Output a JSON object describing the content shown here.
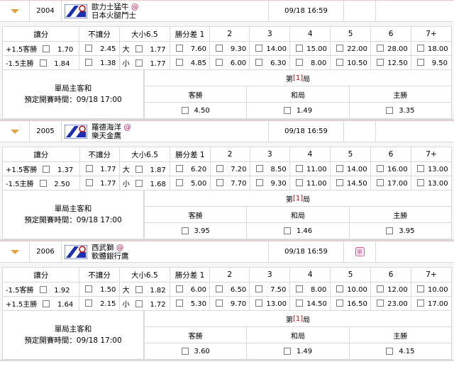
{
  "games": [
    {
      "no": "2004",
      "away": "歐力士猛牛",
      "home": "日本火腿鬥士",
      "at": "@",
      "time": "09/18 16:59",
      "badge": "",
      "headers": [
        "讓分",
        "不讓分",
        "大小6.5",
        "勝分差 1",
        "2",
        "3",
        "4",
        "5",
        "6",
        "7+"
      ],
      "rows": [
        {
          "hcap": "+1.5客勝",
          "hodd": "1.70",
          "nodd": "2.45",
          "ou": "大",
          "ouodd": "1.77",
          "m": [
            "7.60",
            "9.30",
            "14.00",
            "15.00",
            "22.00",
            "28.00",
            "18.00"
          ]
        },
        {
          "hcap": "-1.5主勝",
          "hodd": "1.84",
          "nodd": "1.38",
          "ou": "小",
          "ouodd": "1.77",
          "m": [
            "4.85",
            "6.00",
            "6.30",
            "8.00",
            "10.50",
            "12.50",
            "9.50"
          ]
        }
      ],
      "inning_title": "單局主客和",
      "start": "預定開賽時間：09/18 17:00",
      "inning": [
        "第",
        "1",
        "局"
      ],
      "cols": [
        "客勝",
        "和局",
        "主勝"
      ],
      "codds": [
        "4.50",
        "1.49",
        "3.35"
      ]
    },
    {
      "no": "2005",
      "away": "羅德海洋",
      "home": "樂天金鷹",
      "at": "@",
      "time": "09/18 16:59",
      "badge": "",
      "headers": [
        "讓分",
        "不讓分",
        "大小6.5",
        "勝分差 1",
        "2",
        "3",
        "4",
        "5",
        "6",
        "7+"
      ],
      "rows": [
        {
          "hcap": "+1.5客勝",
          "hodd": "1.37",
          "nodd": "1.77",
          "ou": "大",
          "ouodd": "1.87",
          "m": [
            "6.20",
            "7.20",
            "8.50",
            "11.00",
            "14.00",
            "16.00",
            "13.00"
          ]
        },
        {
          "hcap": "-1.5主勝",
          "hodd": "2.50",
          "nodd": "1.77",
          "ou": "小",
          "ouodd": "1.68",
          "m": [
            "5.00",
            "7.70",
            "9.30",
            "11.00",
            "14.50",
            "17.00",
            "13.00"
          ]
        }
      ],
      "inning_title": "單局主客和",
      "start": "預定開賽時間：09/18 17:00",
      "inning": [
        "第",
        "1",
        "局"
      ],
      "cols": [
        "客勝",
        "和局",
        "主勝"
      ],
      "codds": [
        "3.95",
        "1.46",
        "3.95"
      ]
    },
    {
      "no": "2006",
      "away": "西武獅",
      "home": "軟體銀行鷹",
      "at": "@",
      "time": "09/18 16:59",
      "badge": "單",
      "headers": [
        "讓分",
        "不讓分",
        "大小6.5",
        "勝分差 1",
        "2",
        "3",
        "4",
        "5",
        "6",
        "7+"
      ],
      "rows": [
        {
          "hcap": "-1.5客勝",
          "hodd": "1.92",
          "nodd": "1.50",
          "ou": "大",
          "ouodd": "1.82",
          "m": [
            "6.00",
            "6.50",
            "7.50",
            "8.00",
            "10.00",
            "12.00",
            "10.00"
          ]
        },
        {
          "hcap": "+1.5主勝",
          "hodd": "1.64",
          "nodd": "2.15",
          "ou": "小",
          "ouodd": "1.72",
          "m": [
            "5.30",
            "9.70",
            "13.00",
            "14.50",
            "16.50",
            "23.00",
            "17.00"
          ]
        }
      ],
      "inning_title": "單局主客和",
      "start": "預定開賽時間：09/18 17:00",
      "inning": [
        "第",
        "1",
        "局"
      ],
      "cols": [
        "客勝",
        "和局",
        "主勝"
      ],
      "codds": [
        "3.60",
        "1.49",
        "4.15"
      ]
    }
  ],
  "colors": {
    "accent": "#e8a13a",
    "red": "#cc0000",
    "border": "#d9d9d9"
  }
}
